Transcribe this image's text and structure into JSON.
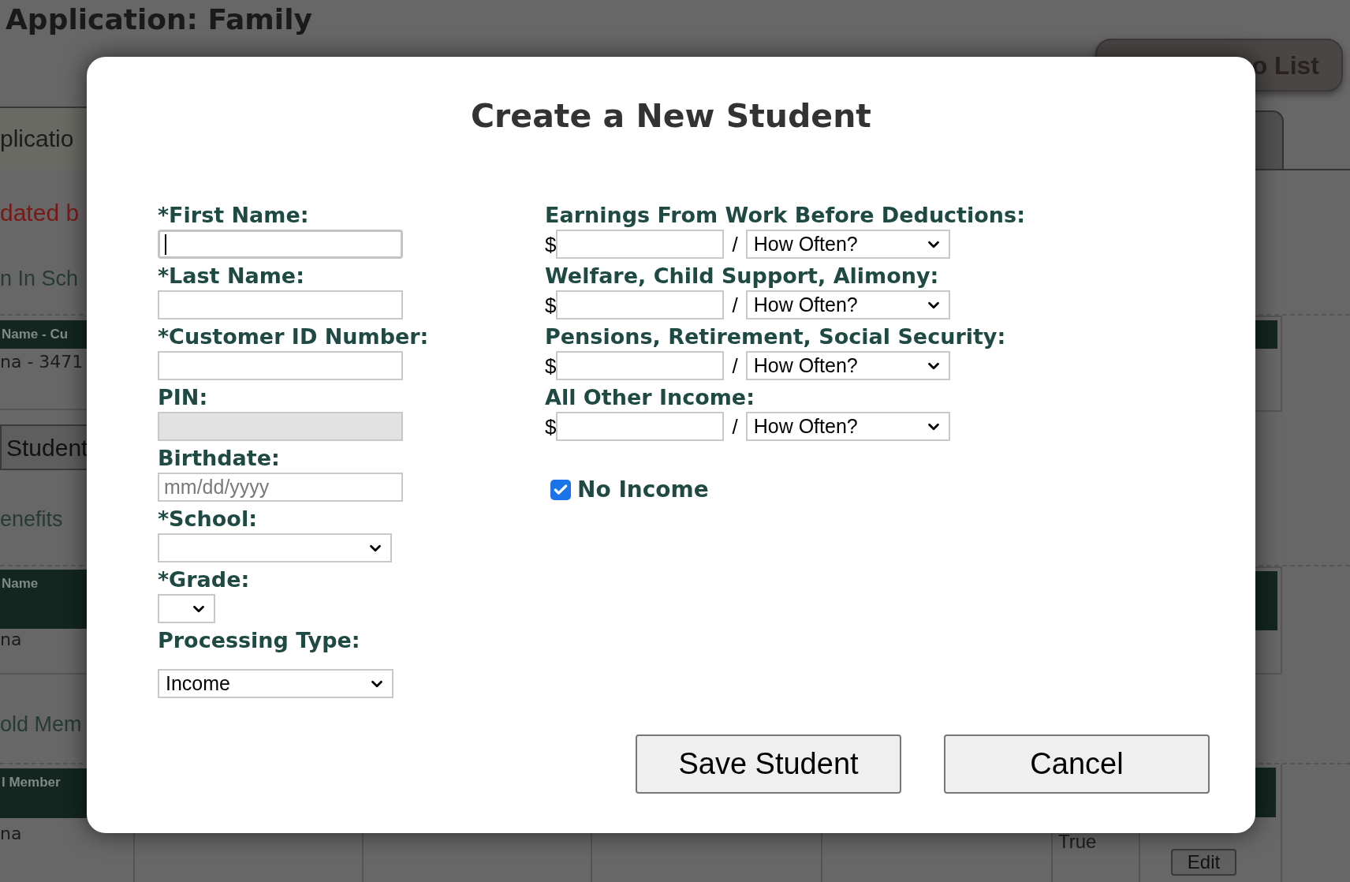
{
  "page": {
    "title": "Application: Family",
    "back_button": "o List",
    "left_fragments": [
      {
        "kind": "tab",
        "text": "plicatio"
      },
      {
        "kind": "alert",
        "text": "dated b"
      },
      {
        "kind": "heading",
        "text": "n In Sch"
      },
      {
        "kind": "table_header",
        "text": "Name - Cu"
      },
      {
        "kind": "cell",
        "text": "na - 3471"
      },
      {
        "kind": "button",
        "text": "Student"
      },
      {
        "kind": "heading",
        "text": "enefits"
      },
      {
        "kind": "table_header",
        "text": "Name"
      },
      {
        "kind": "cell",
        "text": "na"
      },
      {
        "kind": "heading",
        "text": "old Mem"
      },
      {
        "kind": "table_header",
        "text": "l Member"
      },
      {
        "kind": "cell",
        "text": "na"
      }
    ],
    "bottom_cell": "True",
    "edit_button": "Edit"
  },
  "dialog": {
    "title": "Create a New Student",
    "left_fields": [
      {
        "kind": "text",
        "label": "*First Name:",
        "focused": true,
        "disabled": false
      },
      {
        "kind": "text",
        "label": "*Last Name:",
        "focused": false,
        "disabled": false
      },
      {
        "kind": "text",
        "label": "*Customer ID Number:",
        "focused": false,
        "disabled": false
      },
      {
        "kind": "text",
        "label": "PIN:",
        "focused": false,
        "disabled": true
      },
      {
        "kind": "text",
        "label": "Birthdate:",
        "placeholder": "mm/dd/yyyy",
        "focused": false,
        "disabled": false
      },
      {
        "kind": "select",
        "label": "*School:"
      },
      {
        "kind": "select",
        "label": "*Grade:"
      },
      {
        "kind": "select",
        "label": "Processing Type:",
        "value": "Income"
      }
    ],
    "income": [
      {
        "label": "Earnings From Work Before Deductions:",
        "currency": "$",
        "separator": "/",
        "frequency": "How Often?"
      },
      {
        "label": "Welfare, Child Support, Alimony:",
        "currency": "$",
        "separator": "/",
        "frequency": "How Often?"
      },
      {
        "label": "Pensions, Retirement, Social Security:",
        "currency": "$",
        "separator": "/",
        "frequency": "How Often?"
      },
      {
        "label": "All Other Income:",
        "currency": "$",
        "separator": "/",
        "frequency": "How Often?"
      }
    ],
    "no_income": {
      "label": "No Income",
      "checked": true
    },
    "buttons": [
      "Save Student",
      "Cancel"
    ]
  }
}
